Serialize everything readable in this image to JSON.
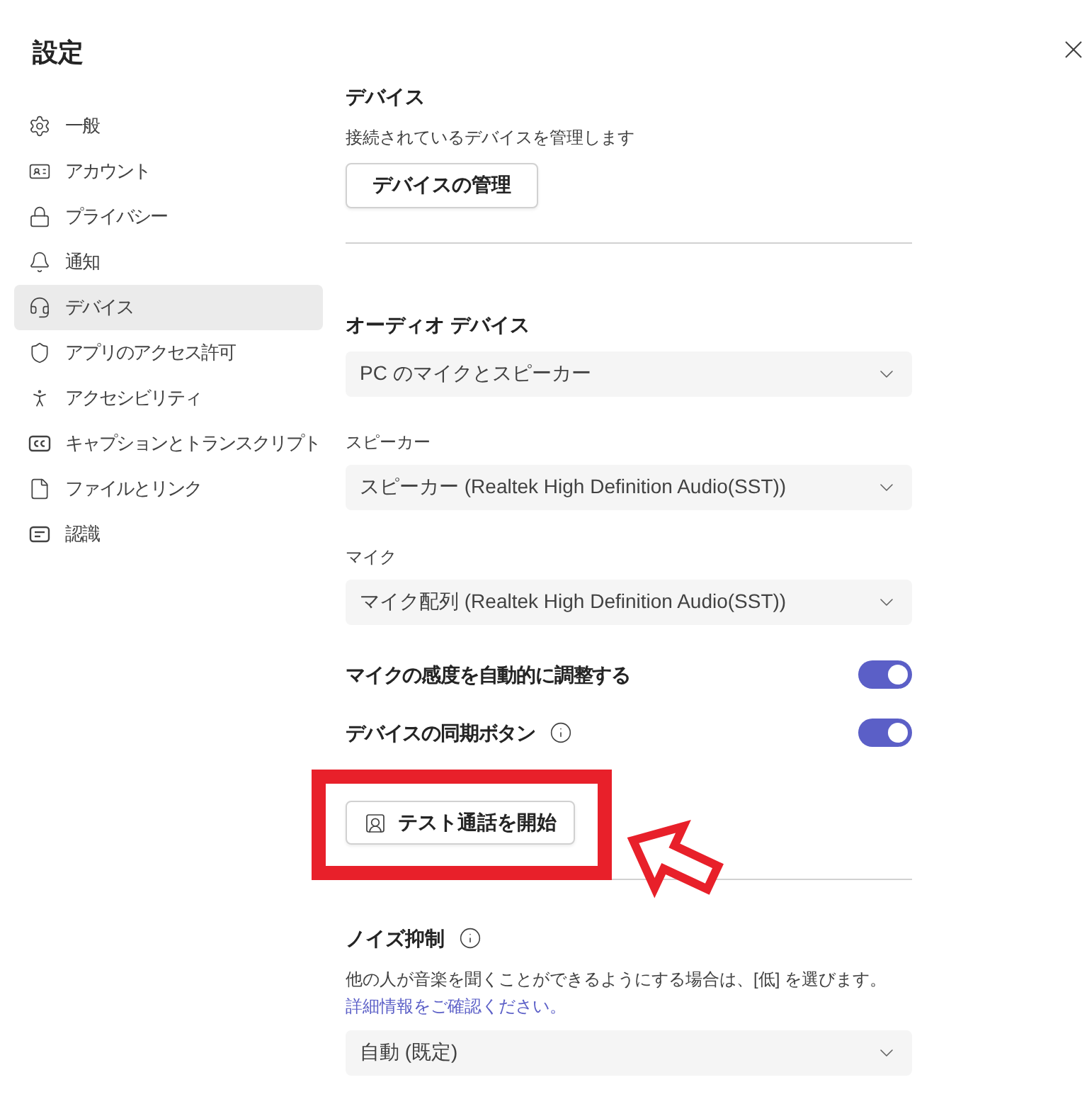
{
  "window": {
    "title": "設定"
  },
  "sidebar": {
    "items": [
      {
        "label": "一般",
        "selected": false
      },
      {
        "label": "アカウント",
        "selected": false
      },
      {
        "label": "プライバシー",
        "selected": false
      },
      {
        "label": "通知",
        "selected": false
      },
      {
        "label": "デバイス",
        "selected": true
      },
      {
        "label": "アプリのアクセス許可",
        "selected": false
      },
      {
        "label": "アクセシビリティ",
        "selected": false
      },
      {
        "label": "キャプションとトランスクリプト",
        "selected": false
      },
      {
        "label": "ファイルとリンク",
        "selected": false
      },
      {
        "label": "認識",
        "selected": false
      }
    ]
  },
  "devices": {
    "title": "デバイス",
    "description": "接続されているデバイスを管理します",
    "button": "デバイスの管理"
  },
  "audio_devices": {
    "title": "オーディオ デバイス",
    "dropdown": {
      "value": "PC のマイクとスピーカー"
    },
    "speaker": {
      "label": "スピーカー",
      "value": "スピーカー (Realtek High Definition Audio(SST))"
    },
    "microphone": {
      "label": "マイク",
      "value": "マイク配列 (Realtek High Definition Audio(SST))"
    },
    "toggles": [
      {
        "label": "マイクの感度を自動的に調整する",
        "on": true,
        "info": false
      },
      {
        "label": "デバイスの同期ボタン",
        "on": true,
        "info": true
      }
    ]
  },
  "test_call": {
    "button": "テスト通話を開始",
    "highlighted": true
  },
  "noise_suppression": {
    "title": "ノイズ抑制",
    "info": true,
    "description": "他の人が音楽を聞くことができるようにする場合は、[低] を選びます。",
    "link": "詳細情報をご確認ください。",
    "dropdown": {
      "value": "自動 (既定)"
    }
  }
}
